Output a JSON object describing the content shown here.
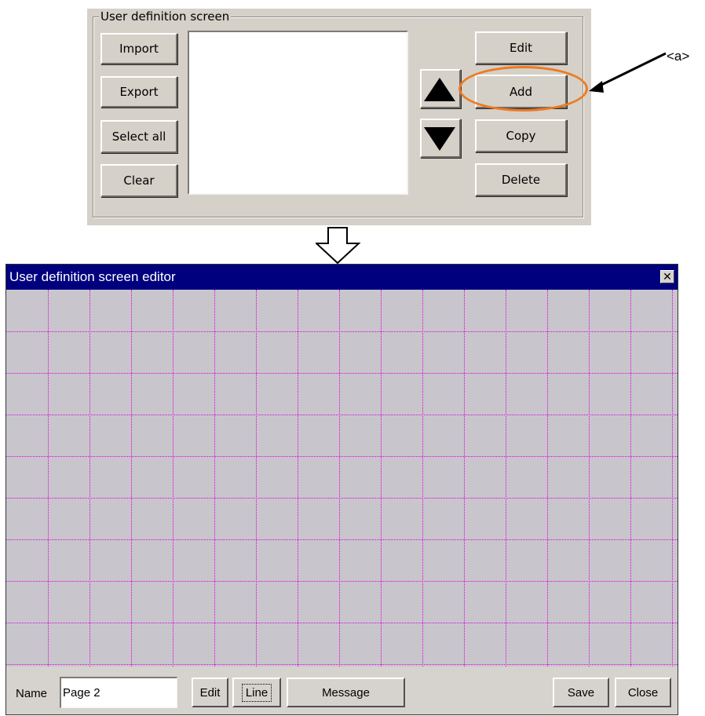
{
  "dialog": {
    "group_title": "User definition screen",
    "left_buttons": [
      "Import",
      "Export",
      "Select all",
      "Clear"
    ],
    "right_buttons": [
      "Edit",
      "Add",
      "Copy",
      "Delete"
    ],
    "move_up_icon": "triangle-up-icon",
    "move_down_icon": "triangle-down-icon"
  },
  "annotation": {
    "label": "<a>",
    "highlight_color": "#ee7a22",
    "arrow_icon": "down-arrow-outline-icon"
  },
  "editor": {
    "title": "User definition screen editor",
    "close_glyph": "✕",
    "title_bar_color": "#00007f",
    "grid_color": "#e000e0",
    "name_label": "Name",
    "name_value": "Page 2",
    "buttons": {
      "edit": "Edit",
      "line": "Line",
      "message": "Message",
      "save": "Save",
      "close": "Close"
    }
  }
}
